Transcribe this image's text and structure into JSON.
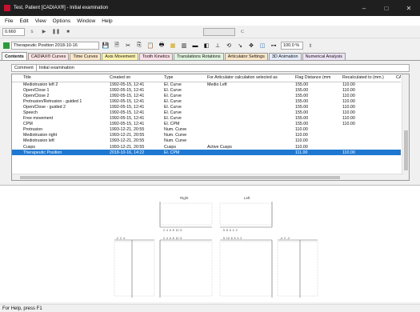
{
  "window": {
    "title": "Test, Patient [CADIAX®] - Initial examination",
    "minimize": "–",
    "maximize": "□",
    "close": "✕"
  },
  "menu": [
    "File",
    "Edit",
    "View",
    "Options",
    "Window",
    "Help"
  ],
  "toolbar": {
    "time_value": "0.660",
    "time_unit": "s",
    "zoom_value": "100.0 %",
    "position_select": "Therapeutic Position 2018-10-16"
  },
  "tabs": [
    "Contents",
    "CADIAX® Curves",
    "Time Curves",
    "Axis Movement",
    "Tooth Kinetics",
    "Translations Rotations",
    "Articulator Settings",
    "3D Animation",
    "Numerical Analysis"
  ],
  "comment": {
    "label": "Comment",
    "value": "Initial examination"
  },
  "table": {
    "headers": [
      "Title",
      "Created on",
      "Type",
      "For Articulator calculation selected as",
      "Flag Distance (mm.)",
      "Recalculated to (mm.)",
      "CAE"
    ],
    "rows": [
      [
        "Mediotrusion left 2",
        "1992-05-15, 12:41",
        "El. Curve",
        "Medio Left",
        "155.00",
        "110.00",
        ""
      ],
      [
        "Open/Close 1",
        "1992-05-15, 12:41",
        "El. Curve",
        "",
        "155.00",
        "110.00",
        ""
      ],
      [
        "Open/Close 2",
        "1992-05-15, 12:41",
        "El. Curve",
        "",
        "155.00",
        "110.00",
        ""
      ],
      [
        "Protrusion/Retrusion - guided 1",
        "1992-05-15, 12:41",
        "El. Curve",
        "",
        "155.00",
        "110.00",
        ""
      ],
      [
        "Open/Close - guided 2",
        "1992-05-15, 12:41",
        "El. Curve",
        "",
        "155.00",
        "110.00",
        ""
      ],
      [
        "Speech",
        "1992-05-15, 12:41",
        "El. Curve",
        "",
        "155.00",
        "110.00",
        ""
      ],
      [
        "Free movement",
        "1992-05-15, 12:41",
        "El. Curve",
        "",
        "155.00",
        "110.00",
        ""
      ],
      [
        "CPM",
        "1992-05-15, 12:41",
        "El. CPM",
        "",
        "155.00",
        "110.00",
        ""
      ],
      [
        "Protrusion",
        "1993-12-21, 20:55",
        "Num. Curve",
        "",
        "110.00",
        "",
        ""
      ],
      [
        "Mediotrusion right",
        "1993-12-21, 20:55",
        "Num. Curve",
        "",
        "110.00",
        "",
        ""
      ],
      [
        "Mediotrusion left",
        "1993-12-21, 20:55",
        "Num. Curve",
        "",
        "110.00",
        "",
        ""
      ],
      [
        "Cusps",
        "1993-12-21, 20:55",
        "Cusps",
        "Active Cusps",
        "110.00",
        "",
        ""
      ],
      [
        "Therapeutic Position",
        "2018-10-16, 14:22",
        "El. CPM",
        "",
        "111.00",
        "110.00",
        ""
      ]
    ],
    "selected_row": 12
  },
  "viewer": {
    "right_label": "Right",
    "left_label": "Left",
    "scale_top": "2  4  6  8  10  5",
    "scale_top_left": "5  8  6  4  2",
    "scale_bottom_left": "-2  2  4",
    "scale_bottom_mid": "2  4  6  8  10  5",
    "scale_bottom_mid2": "5  10  8  6  4  2",
    "scale_bottom_right": "-4  2  -2"
  },
  "status": "For Help, press F1",
  "colors": {
    "selection": "#1e78d2",
    "titlebar": "#1f1f1f"
  }
}
